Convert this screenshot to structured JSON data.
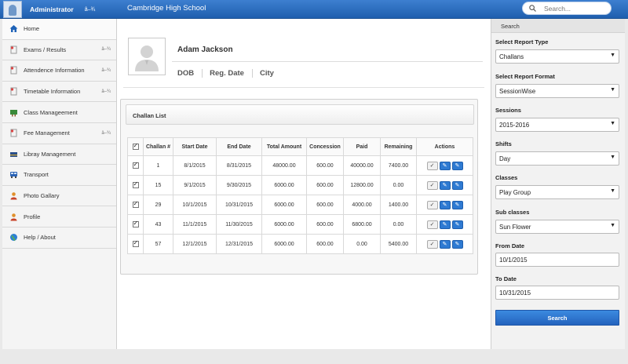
{
  "header": {
    "admin_name": "Administrator",
    "admin_caret": "â–¾",
    "school_name": "Cambridge High School",
    "search_placeholder": "Search..."
  },
  "sidebar": {
    "items": [
      {
        "label": "Home",
        "icon": "home-icon",
        "caret": ""
      },
      {
        "label": "Exams / Results",
        "icon": "document-icon",
        "caret": "â–¾"
      },
      {
        "label": "Attendence Information",
        "icon": "document-icon",
        "caret": "â–¾"
      },
      {
        "label": "Timetable Information",
        "icon": "document-icon",
        "caret": "â–¾"
      },
      {
        "label": "Class Manageement",
        "icon": "class-icon",
        "caret": ""
      },
      {
        "label": "Fee Management",
        "icon": "document-icon",
        "caret": "â–¾"
      },
      {
        "label": "Libray Management",
        "icon": "books-icon",
        "caret": ""
      },
      {
        "label": "Transport",
        "icon": "bus-icon",
        "caret": ""
      },
      {
        "label": "Photo Gallary",
        "icon": "person-icon",
        "caret": ""
      },
      {
        "label": "Profile",
        "icon": "person-icon",
        "caret": ""
      },
      {
        "label": "Help / About",
        "icon": "globe-icon",
        "caret": ""
      }
    ]
  },
  "profile": {
    "name": "Adam Jackson",
    "dob_label": "DOB",
    "reg_date_label": "Reg. Date",
    "city_label": "City"
  },
  "challan_panel": {
    "title": "Challan List",
    "columns": [
      "Challan #",
      "Start Date",
      "End Date",
      "Total Amount",
      "Concession",
      "Paid",
      "Remaining",
      "Actions"
    ],
    "rows": [
      {
        "challan": "1",
        "start": "8/1/2015",
        "end": "8/31/2015",
        "total": "48000.00",
        "concession": "600.00",
        "paid": "40000.00",
        "remaining": "7400.00"
      },
      {
        "challan": "15",
        "start": "9/1/2015",
        "end": "9/30/2015",
        "total": "6000.00",
        "concession": "600.00",
        "paid": "12800.00",
        "remaining": "0.00"
      },
      {
        "challan": "29",
        "start": "10/1/2015",
        "end": "10/31/2015",
        "total": "6000.00",
        "concession": "600.00",
        "paid": "4000.00",
        "remaining": "1400.00"
      },
      {
        "challan": "43",
        "start": "11/1/2015",
        "end": "11/30/2015",
        "total": "6000.00",
        "concession": "600.00",
        "paid": "6800.00",
        "remaining": "0.00"
      },
      {
        "challan": "57",
        "start": "12/1/2015",
        "end": "12/31/2015",
        "total": "6000.00",
        "concession": "600.00",
        "paid": "0.00",
        "remaining": "5400.00"
      }
    ]
  },
  "search_panel": {
    "title": "Search",
    "report_type_label": "Select Report Type",
    "report_type_value": "Challans",
    "report_format_label": "Select Report Format",
    "report_format_value": "SessionWise",
    "sessions_label": "Sessions",
    "sessions_value": "2015-2016",
    "shifts_label": "Shifts",
    "shifts_value": "Day",
    "classes_label": "Classes",
    "classes_value": "Play Group",
    "subclasses_label": "Sub classes",
    "subclasses_value": "Sun Flower",
    "from_date_label": "From Date",
    "from_date_value": "10/1/2015",
    "to_date_label": "To Date",
    "to_date_value": "10/31/2015",
    "search_button": "Search"
  },
  "colors": {
    "header_blue": "#2a6cbf",
    "button_blue": "#2e7ad2"
  }
}
